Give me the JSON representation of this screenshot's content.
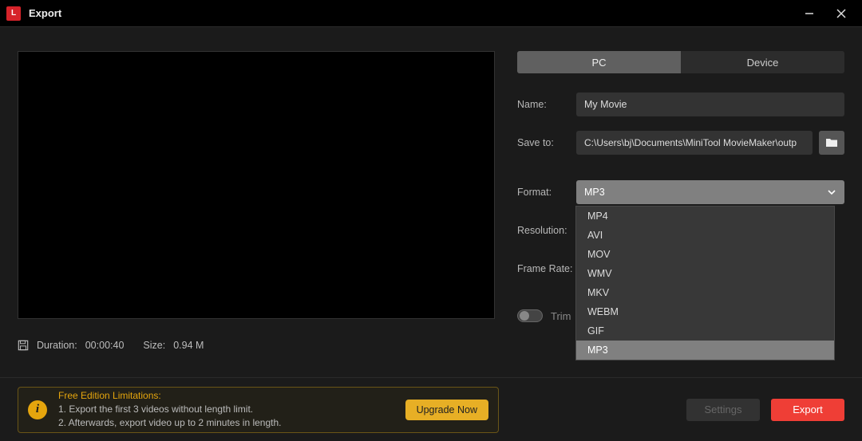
{
  "titlebar": {
    "app_icon_letter": "L",
    "title": "Export"
  },
  "preview": {},
  "meta": {
    "duration_label": "Duration:",
    "duration_value": "00:00:40",
    "size_label": "Size:",
    "size_value": "0.94 M"
  },
  "tabs": {
    "pc": "PC",
    "device": "Device"
  },
  "form": {
    "name_label": "Name:",
    "name_value": "My Movie",
    "save_label": "Save to:",
    "save_value": "C:\\Users\\bj\\Documents\\MiniTool MovieMaker\\outp",
    "format_label": "Format:",
    "format_value": "MP3",
    "resolution_label": "Resolution:",
    "framerate_label": "Frame Rate:",
    "trim_label": "Trim"
  },
  "format_options": [
    "MP4",
    "AVI",
    "MOV",
    "WMV",
    "MKV",
    "WEBM",
    "GIF",
    "MP3"
  ],
  "promo": {
    "title": "Free Edition Limitations:",
    "line1": "1. Export the first 3 videos without length limit.",
    "line2": "2. Afterwards, export video up to 2 minutes in length.",
    "upgrade": "Upgrade Now"
  },
  "footer": {
    "settings": "Settings",
    "export": "Export"
  }
}
